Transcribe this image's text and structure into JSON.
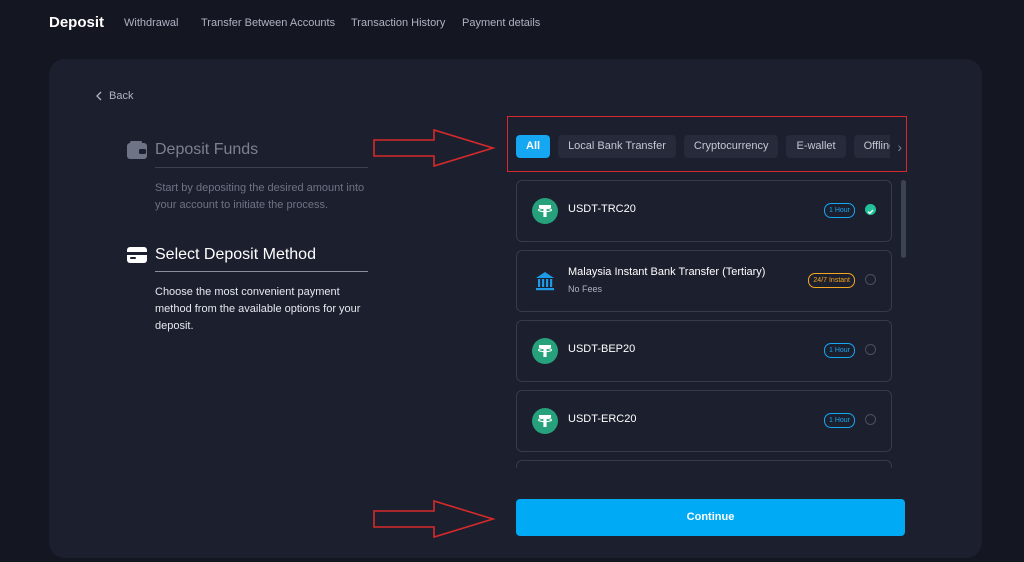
{
  "nav": {
    "tabs": [
      {
        "label": "Deposit",
        "active": true
      },
      {
        "label": "Withdrawal"
      },
      {
        "label": "Transfer Between Accounts"
      },
      {
        "label": "Transaction History"
      },
      {
        "label": "Payment details"
      }
    ]
  },
  "back": {
    "label": "Back",
    "icon": "chevron-left-icon"
  },
  "steps": [
    {
      "icon": "wallet-icon",
      "title": "Deposit Funds",
      "desc": "Start by depositing the desired amount into your account to initiate the process."
    },
    {
      "icon": "card-icon",
      "title": "Select Deposit Method",
      "desc": "Choose the most convenient payment method from the available options for your deposit."
    }
  ],
  "filters": [
    "All",
    "Local Bank Transfer",
    "Cryptocurrency",
    "E-wallet",
    "Offline"
  ],
  "methods": [
    {
      "name": "USDT-TRC20",
      "badge": "1 Hour",
      "icon": "tether-icon",
      "selected": true
    },
    {
      "name": "Malaysia Instant Bank Transfer (Tertiary)",
      "sub": "No Fees",
      "badge": "24/7 Instant",
      "icon": "bank-icon",
      "selected": false
    },
    {
      "name": "USDT-BEP20",
      "badge": "1 Hour",
      "icon": "tether-icon",
      "selected": false
    },
    {
      "name": "USDT-ERC20",
      "badge": "1 Hour",
      "icon": "tether-icon",
      "selected": false
    }
  ],
  "continue_label": "Continue",
  "colors": {
    "accent": "#16a7f3",
    "success": "#21c29a",
    "badge_orange": "#f5a623",
    "annotation": "#d62a2a",
    "tether": "#26a17b"
  }
}
